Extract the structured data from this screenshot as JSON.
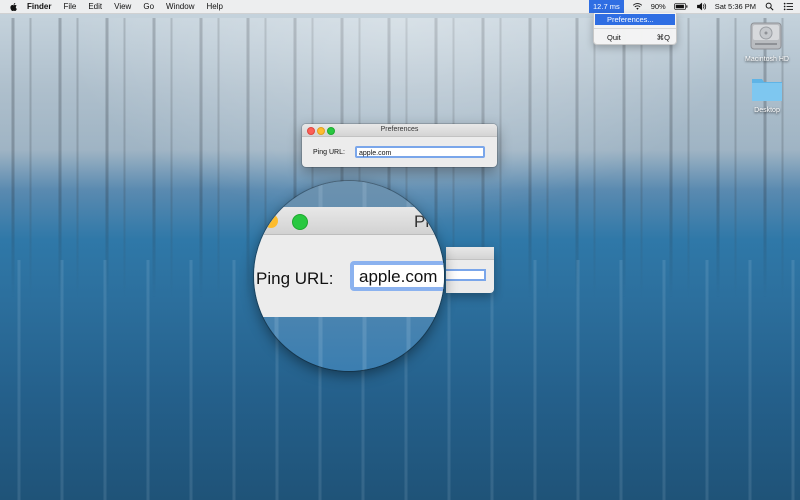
{
  "menubar": {
    "app_name": "Finder",
    "menus": [
      "File",
      "Edit",
      "View",
      "Go",
      "Window",
      "Help"
    ],
    "ping_extra": "12.7 ms",
    "battery": "90%",
    "clock": "Sat 5:36 PM",
    "icons": [
      "apple-icon",
      "wifi-icon",
      "battery-icon",
      "volume-icon",
      "search-icon",
      "list-icon"
    ]
  },
  "dropdown": {
    "items": [
      {
        "label": "Preferences...",
        "shortcut": ""
      },
      {
        "label": "Quit",
        "shortcut": "⌘Q"
      }
    ]
  },
  "desktop": {
    "icons": [
      {
        "label": "Macintosh HD",
        "icon": "hard-drive-icon"
      },
      {
        "label": "Desktop",
        "icon": "folder-icon"
      }
    ]
  },
  "prefs_window": {
    "title": "Preferences",
    "ping_label": "Ping URL:",
    "ping_value": "apple.com"
  },
  "magnifier": {
    "title_fragment": "Pr",
    "ping_label": "Ping URL:",
    "ping_value": "apple.com"
  },
  "colors": {
    "menu_highlight": "#2f6ee3",
    "focus_ring": "#7aa6ea",
    "close": "#fc5f56",
    "minimize": "#fdbc2e",
    "zoom": "#28c840"
  }
}
